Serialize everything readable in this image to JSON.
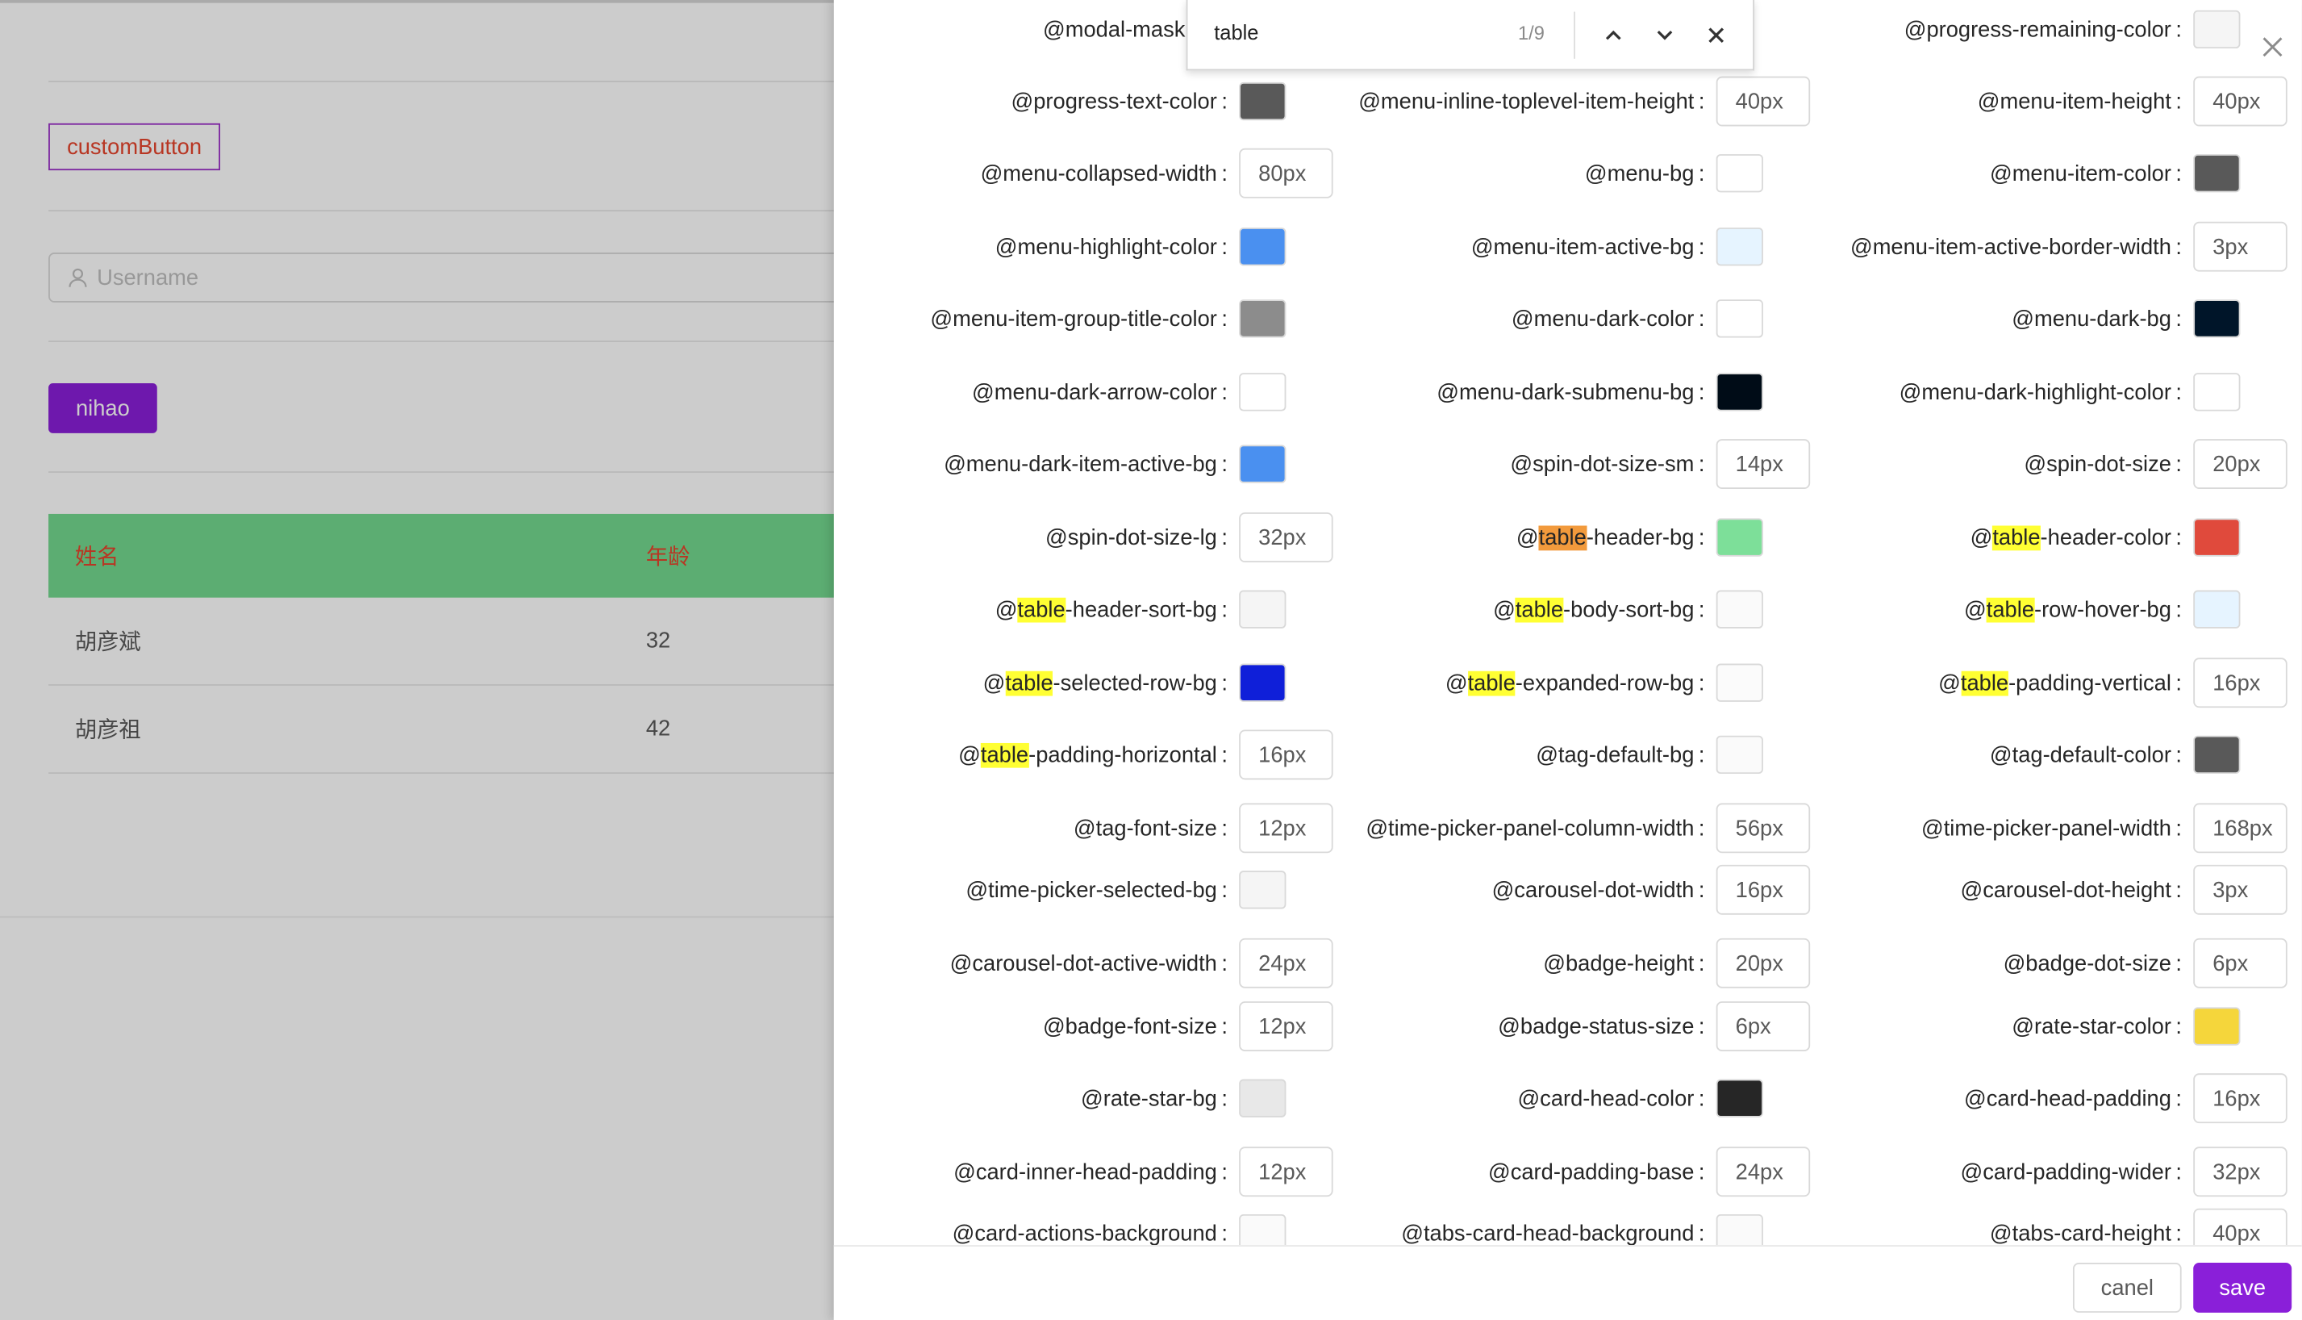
{
  "background_app": {
    "custom_button_label": "customButton",
    "username_placeholder": "Username",
    "nihao_button_label": "nihao",
    "table": {
      "headers": [
        "姓名",
        "年龄"
      ],
      "rows": [
        [
          "胡彦斌",
          "32"
        ],
        [
          "胡彦祖",
          "42"
        ]
      ]
    }
  },
  "find_bar": {
    "query": "table",
    "match_count": "1/9"
  },
  "drawer": {
    "footer": {
      "cancel_label": "canel",
      "save_label": "save"
    },
    "items": [
      {
        "name": "@modal-mask-bg",
        "type": "color",
        "value": "#4d4d4d"
      },
      {
        "name": "",
        "type": "none"
      },
      {
        "name": "@progress-remaining-color",
        "type": "color",
        "value": "#f5f5f5"
      },
      {
        "name": "@progress-text-color",
        "type": "color",
        "value": "#595959"
      },
      {
        "name": "@menu-inline-toplevel-item-height",
        "type": "text",
        "value": "40px"
      },
      {
        "name": "@menu-item-height",
        "type": "text",
        "value": "40px"
      },
      {
        "name": "@menu-collapsed-width",
        "type": "text",
        "value": "80px"
      },
      {
        "name": "@menu-bg",
        "type": "color",
        "value": "#ffffff"
      },
      {
        "name": "@menu-item-color",
        "type": "color",
        "value": "#595959"
      },
      {
        "name": "@menu-highlight-color",
        "type": "color",
        "value": "#4a90f0"
      },
      {
        "name": "@menu-item-active-bg",
        "type": "color",
        "value": "#e6f4ff"
      },
      {
        "name": "@menu-item-active-border-width",
        "type": "text",
        "value": "3px"
      },
      {
        "name": "@menu-item-group-title-color",
        "type": "color",
        "value": "#8c8c8c"
      },
      {
        "name": "@menu-dark-color",
        "type": "color",
        "value": "#ffffff"
      },
      {
        "name": "@menu-dark-bg",
        "type": "color",
        "value": "#001529"
      },
      {
        "name": "@menu-dark-arrow-color",
        "type": "color",
        "value": "#ffffff"
      },
      {
        "name": "@menu-dark-submenu-bg",
        "type": "color",
        "value": "#000c17"
      },
      {
        "name": "@menu-dark-highlight-color",
        "type": "color",
        "value": "#ffffff"
      },
      {
        "name": "@menu-dark-item-active-bg",
        "type": "color",
        "value": "#4a90f0"
      },
      {
        "name": "@spin-dot-size-sm",
        "type": "text",
        "value": "14px"
      },
      {
        "name": "@spin-dot-size",
        "type": "text",
        "value": "20px"
      },
      {
        "name": "@spin-dot-size-lg",
        "type": "text",
        "value": "32px"
      },
      {
        "name": "@table-header-bg",
        "type": "color",
        "value": "#7ddf99"
      },
      {
        "name": "@table-header-color",
        "type": "color",
        "value": "#e04a3c"
      },
      {
        "name": "@table-header-sort-bg",
        "type": "color",
        "value": "#f5f5f5"
      },
      {
        "name": "@table-body-sort-bg",
        "type": "color",
        "value": "#fafafa"
      },
      {
        "name": "@table-row-hover-bg",
        "type": "color",
        "value": "#e6f4ff"
      },
      {
        "name": "@table-selected-row-bg",
        "type": "color",
        "value": "#0f1fd9"
      },
      {
        "name": "@table-expanded-row-bg",
        "type": "color",
        "value": "#fbfbfb"
      },
      {
        "name": "@table-padding-vertical",
        "type": "text",
        "value": "16px"
      },
      {
        "name": "@table-padding-horizontal",
        "type": "text",
        "value": "16px"
      },
      {
        "name": "@tag-default-bg",
        "type": "color",
        "value": "#fafafa"
      },
      {
        "name": "@tag-default-color",
        "type": "color",
        "value": "#595959"
      },
      {
        "name": "@tag-font-size",
        "type": "text",
        "value": "12px"
      },
      {
        "name": "@time-picker-panel-column-width",
        "type": "text",
        "value": "56px"
      },
      {
        "name": "@time-picker-panel-width",
        "type": "text",
        "value": "168px"
      },
      {
        "name": "@time-picker-selected-bg",
        "type": "color",
        "value": "#f5f5f5"
      },
      {
        "name": "@carousel-dot-width",
        "type": "text",
        "value": "16px"
      },
      {
        "name": "@carousel-dot-height",
        "type": "text",
        "value": "3px"
      },
      {
        "name": "@carousel-dot-active-width",
        "type": "text",
        "value": "24px"
      },
      {
        "name": "@badge-height",
        "type": "text",
        "value": "20px"
      },
      {
        "name": "@badge-dot-size",
        "type": "text",
        "value": "6px"
      },
      {
        "name": "@badge-font-size",
        "type": "text",
        "value": "12px"
      },
      {
        "name": "@badge-status-size",
        "type": "text",
        "value": "6px"
      },
      {
        "name": "@rate-star-color",
        "type": "color",
        "value": "#f5d63b"
      },
      {
        "name": "@rate-star-bg",
        "type": "color",
        "value": "#e8e8e8"
      },
      {
        "name": "@card-head-color",
        "type": "color",
        "value": "#262626"
      },
      {
        "name": "@card-head-padding",
        "type": "text",
        "value": "16px"
      },
      {
        "name": "@card-inner-head-padding",
        "type": "text",
        "value": "12px"
      },
      {
        "name": "@card-padding-base",
        "type": "text",
        "value": "24px"
      },
      {
        "name": "@card-padding-wider",
        "type": "text",
        "value": "32px"
      },
      {
        "name": "@card-actions-background",
        "type": "color",
        "value": "#fafafa"
      },
      {
        "name": "@tabs-card-head-background",
        "type": "color",
        "value": "#fafafa"
      },
      {
        "name": "@tabs-card-height",
        "type": "text",
        "value": "40px"
      }
    ]
  }
}
